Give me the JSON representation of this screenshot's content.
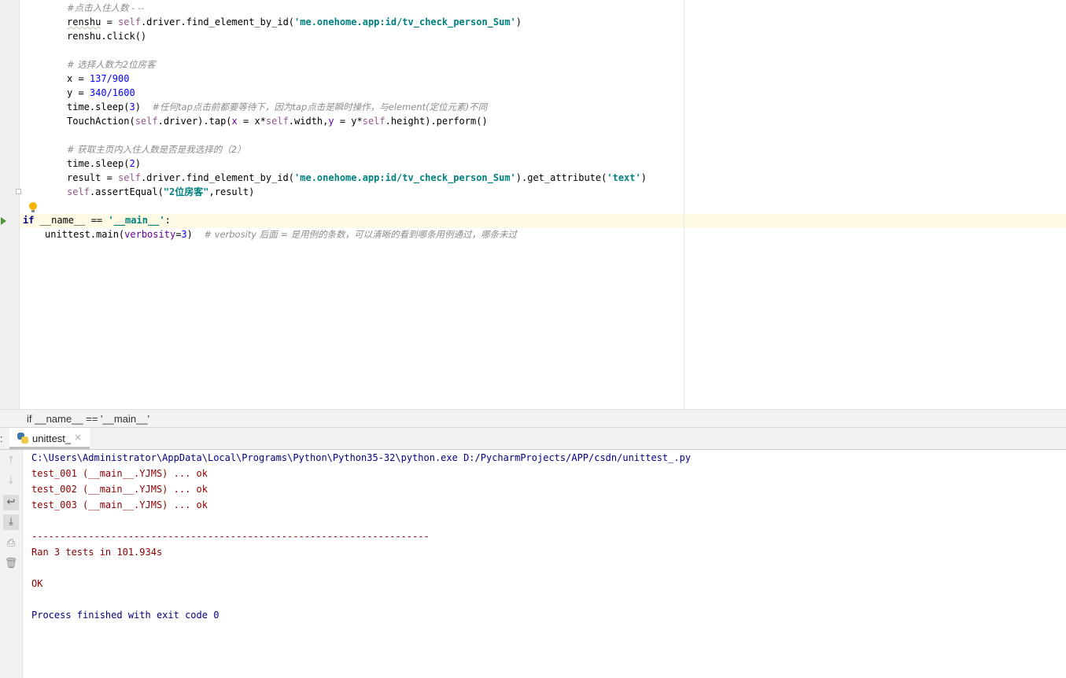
{
  "editor": {
    "lines": {
      "l0": "#点击入住人数 - --",
      "l1_var": "renshu",
      "l1_eq": " = ",
      "l1_self": "self",
      "l1_mid": ".driver.find_element_by_id(",
      "l1_str": "'me.onehome.app:id/tv_check_person_Sum'",
      "l1_end": ")",
      "l2": "renshu.click()",
      "l4": "# 选择人数为2位房客",
      "l5_a": "x = ",
      "l5_b": "137/900",
      "l6_a": "y = ",
      "l6_b": "340/1600",
      "l7_a": "time.sleep(",
      "l7_b": "3",
      "l7_c": ")  ",
      "l7_cmt": "#任何tap点击前都要等待下，因为tap点击是瞬时操作，与element(定位元素)不同",
      "l8_a": "TouchAction(",
      "l8_self": "self",
      "l8_b": ".driver).tap(",
      "l8_x": "x",
      "l8_c": " = x*",
      "l8_self2": "self",
      "l8_d": ".width,",
      "l8_y": "y",
      "l8_e": " = y*",
      "l8_self3": "self",
      "l8_f": ".height).perform()",
      "l10": "# 获取主页内入住人数是否是我选择的（2）",
      "l11_a": "time.sleep(",
      "l11_b": "2",
      "l11_c": ")",
      "l12_a": "result = ",
      "l12_self": "self",
      "l12_b": ".driver.find_element_by_id(",
      "l12_str": "'me.onehome.app:id/tv_check_person_Sum'",
      "l12_c": ").get_attribute(",
      "l12_str2": "'text'",
      "l12_d": ")",
      "l13_self": "self",
      "l13_a": ".assertEqual(",
      "l13_str": "\"2位房客\"",
      "l13_b": ",result)",
      "l15_kw": "if",
      "l15_a": " __name__ == ",
      "l15_str": "'__main__'",
      "l15_b": ":",
      "l16_a": "unittest.main(",
      "l16_param": "verbosity",
      "l16_b": "=",
      "l16_num": "3",
      "l16_c": ")  ",
      "l16_cmt": "# verbosity 后面 = 是用例的条数，可以清晰的看到哪条用例通过，哪条未过"
    }
  },
  "breadcrumb": {
    "text": "if __name__ == '__main__'"
  },
  "run": {
    "colon": ":",
    "tab_label": "unittest_",
    "tab_close": "×"
  },
  "toolbar": {
    "up": "↑",
    "down": "↓",
    "wrap": "↩",
    "scroll_end": "⤓",
    "print": "⎙",
    "trash": "🗑"
  },
  "console": {
    "cmd": "C:\\Users\\Administrator\\AppData\\Local\\Programs\\Python\\Python35-32\\python.exe D:/PycharmProjects/APP/csdn/unittest_.py",
    "t1": "test_001 (__main__.YJMS) ... ok",
    "t2": "test_002 (__main__.YJMS) ... ok",
    "t3": "test_003 (__main__.YJMS) ... ok",
    "sep": "----------------------------------------------------------------------",
    "ran": "Ran 3 tests in 101.934s",
    "ok": "OK",
    "finished": "Process finished with exit code 0"
  }
}
